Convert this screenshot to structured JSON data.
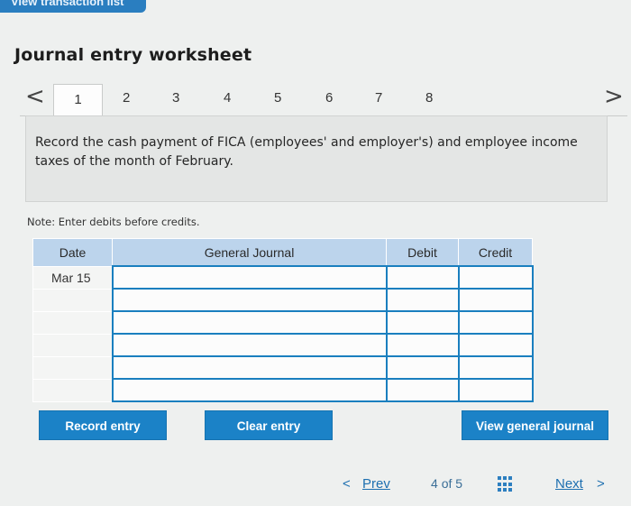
{
  "top_button": {
    "label": "View transaction list"
  },
  "title": "Journal entry worksheet",
  "tabs": {
    "prev_arrow": "<",
    "next_arrow": ">",
    "items": [
      "1",
      "2",
      "3",
      "4",
      "5",
      "6",
      "7",
      "8"
    ],
    "active_index": 0
  },
  "prompt": "Record the cash payment of FICA (employees' and employer's) and employee income taxes of the month of February.",
  "note": "Note: Enter debits before credits.",
  "table": {
    "headers": {
      "date": "Date",
      "general_journal": "General Journal",
      "debit": "Debit",
      "credit": "Credit"
    },
    "rows": [
      {
        "date": "Mar 15",
        "account": "",
        "debit": "",
        "credit": ""
      },
      {
        "date": "",
        "account": "",
        "debit": "",
        "credit": ""
      },
      {
        "date": "",
        "account": "",
        "debit": "",
        "credit": ""
      },
      {
        "date": "",
        "account": "",
        "debit": "",
        "credit": ""
      },
      {
        "date": "",
        "account": "",
        "debit": "",
        "credit": ""
      },
      {
        "date": "",
        "account": "",
        "debit": "",
        "credit": ""
      }
    ]
  },
  "buttons": {
    "record_entry": "Record entry",
    "clear_entry": "Clear entry",
    "view_general_journal": "View general journal"
  },
  "footer": {
    "prev_icon": "<",
    "prev_label": "Prev",
    "page_current": "4",
    "page_of": "of",
    "page_total": "5",
    "next_label": "Next",
    "next_icon": ">"
  },
  "colors": {
    "accent": "#1b82c7",
    "header_bg": "#bcd4ec",
    "input_border": "#1a7fbf"
  }
}
